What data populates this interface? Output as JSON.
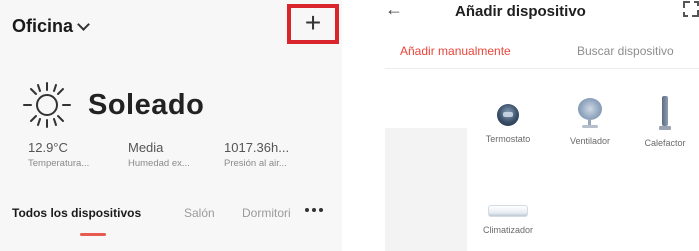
{
  "left": {
    "location_title": "Oficina",
    "add_button_glyph": "+",
    "weather": {
      "condition": "Soleado",
      "icon": "sun-icon"
    },
    "stats": [
      {
        "value": "12.9°C",
        "label": "Temperatura..."
      },
      {
        "value": "Media",
        "label": "Humedad ex..."
      },
      {
        "value": "1017.36h...",
        "label": "Presión al air..."
      }
    ],
    "tabs": [
      {
        "label": "Todos los dispositivos",
        "active": true
      },
      {
        "label": "Salón",
        "active": false
      },
      {
        "label": "Dormitori",
        "active": false
      }
    ],
    "accent_color": "#e85a4f",
    "highlight_color": "#d9252c"
  },
  "right": {
    "title": "Añadir dispositivo",
    "back_glyph": "←",
    "tabs": [
      {
        "label": "Añadir manualmente",
        "active": true
      },
      {
        "label": "Buscar dispositivo",
        "active": false
      }
    ],
    "devices": [
      {
        "label": "Termostato",
        "icon": "thermostat-icon"
      },
      {
        "label": "Ventilador",
        "icon": "fan-icon"
      },
      {
        "label": "Calefactor",
        "icon": "heater-icon"
      },
      {
        "label": "Climatizador",
        "icon": "air-conditioner-icon"
      }
    ],
    "accent_color": "#e8463b"
  }
}
